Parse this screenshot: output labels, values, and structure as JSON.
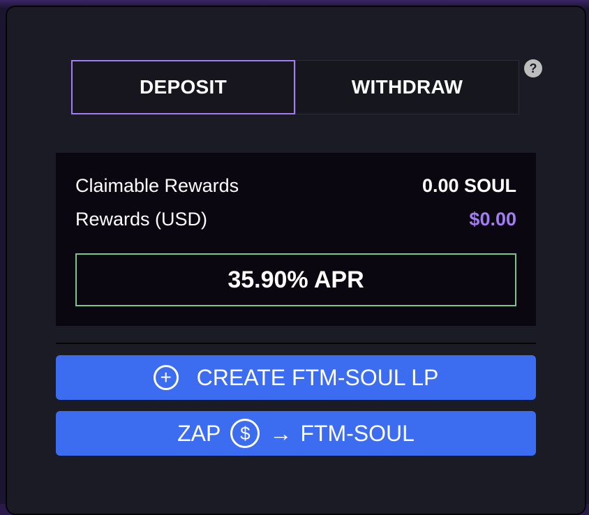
{
  "tabs": {
    "deposit_label": "DEPOSIT",
    "withdraw_label": "WITHDRAW",
    "active": "DEPOSIT"
  },
  "help": {
    "icon": "question-icon",
    "glyph": "?"
  },
  "rewards": {
    "claimable_label": "Claimable Rewards",
    "claimable_value": "0.00 SOUL",
    "usd_label": "Rewards (USD)",
    "usd_value": "$0.00",
    "apr_text": "35.90% APR"
  },
  "actions": {
    "create_lp_label": "CREATE FTM-SOUL LP",
    "create_icon": "plus-circle-icon",
    "create_glyph": "+",
    "zap_label": "ZAP",
    "zap_icon": "dollar-circle-icon",
    "zap_glyph": "$",
    "zap_arrow": "→",
    "zap_target": "FTM-SOUL"
  },
  "colors": {
    "accent_purple": "#a27df2",
    "button_blue": "#3c6cf0",
    "apr_border_green": "#7bc68f",
    "panel_bg": "#1b1b25",
    "rewards_bg": "#0b0711"
  }
}
